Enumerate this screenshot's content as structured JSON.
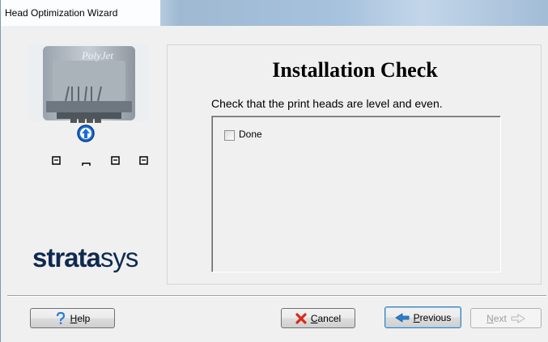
{
  "window": {
    "title": "Head Optimization Wizard"
  },
  "branding": {
    "printer_label": "PolyJet",
    "logo_bold": "strata",
    "logo_light": "sys"
  },
  "page": {
    "heading": "Installation Check",
    "instruction": "Check that the print heads are level and even.",
    "done_label": "Done",
    "done_checked": false
  },
  "buttons": {
    "help": "Help",
    "cancel": "Cancel",
    "previous": "Previous",
    "next": "Next"
  },
  "colors": {
    "brand_navy": "#0f2a4f",
    "cancel_red": "#d9291c",
    "previous_blue": "#2a7fd4",
    "step_indicator_blue": "#1f6fd0"
  },
  "icons": {
    "help": "question-mark-icon",
    "cancel": "red-x-icon",
    "previous": "left-arrow-icon",
    "next": "right-arrow-icon",
    "step": "up-arrow-circle-icon"
  }
}
